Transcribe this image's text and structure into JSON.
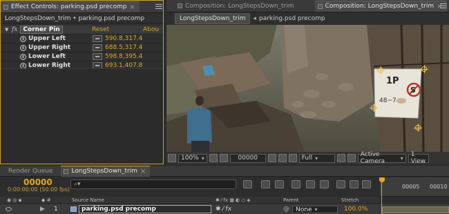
{
  "effect_controls": {
    "tab_label": "Effect Controls: parking.psd precomp",
    "subheader": "LongStepsDown_trim • parking.psd precomp",
    "effect": {
      "name": "Corner Pin",
      "fx_symbol": "fx",
      "reset_label": "Reset",
      "about_label": "Abou"
    },
    "properties": [
      {
        "label": "Upper Left",
        "value": "590.8,317.4"
      },
      {
        "label": "Upper Right",
        "value": "688.5,317.4"
      },
      {
        "label": "Lower Left",
        "value": "598.8,395.4"
      },
      {
        "label": "Lower Right",
        "value": "693.1,407.8"
      }
    ]
  },
  "composition": {
    "tabs": [
      {
        "label": "Composition: LongStepsDown_trim",
        "active": false
      },
      {
        "label": "Composition: LongStepsDown_trim",
        "active": true
      }
    ],
    "breadcrumb": {
      "current": "LongStepsDown_trim",
      "next": "parking.psd precomp"
    },
    "sign": {
      "p_text": "1P",
      "small_text": "48~7"
    },
    "toolbar": {
      "zoom": "100%",
      "timecode": "00000",
      "resolution": "Full",
      "camera": "Active Camera",
      "views": "1 View"
    }
  },
  "timeline": {
    "tabs": [
      {
        "label": "Render Queue",
        "active": false
      },
      {
        "label": "LongStepsDown_trim",
        "active": true
      }
    ],
    "current_time": "00000",
    "time_detail": "0:00:00:00 (50.00 fps)",
    "search_placeholder": "",
    "ruler_labels": [
      "00005",
      "00010"
    ],
    "columns": {
      "source_name": "Source Name",
      "parent": "Parent",
      "stretch": "Stretch"
    },
    "layers": [
      {
        "number": "1",
        "name": "parking.psd precomp",
        "parent": "None",
        "stretch": "100.0%"
      }
    ]
  },
  "colors": {
    "accent": "#e0a81e",
    "panel_border": "#d6a526",
    "background": "#2b2b2b"
  }
}
